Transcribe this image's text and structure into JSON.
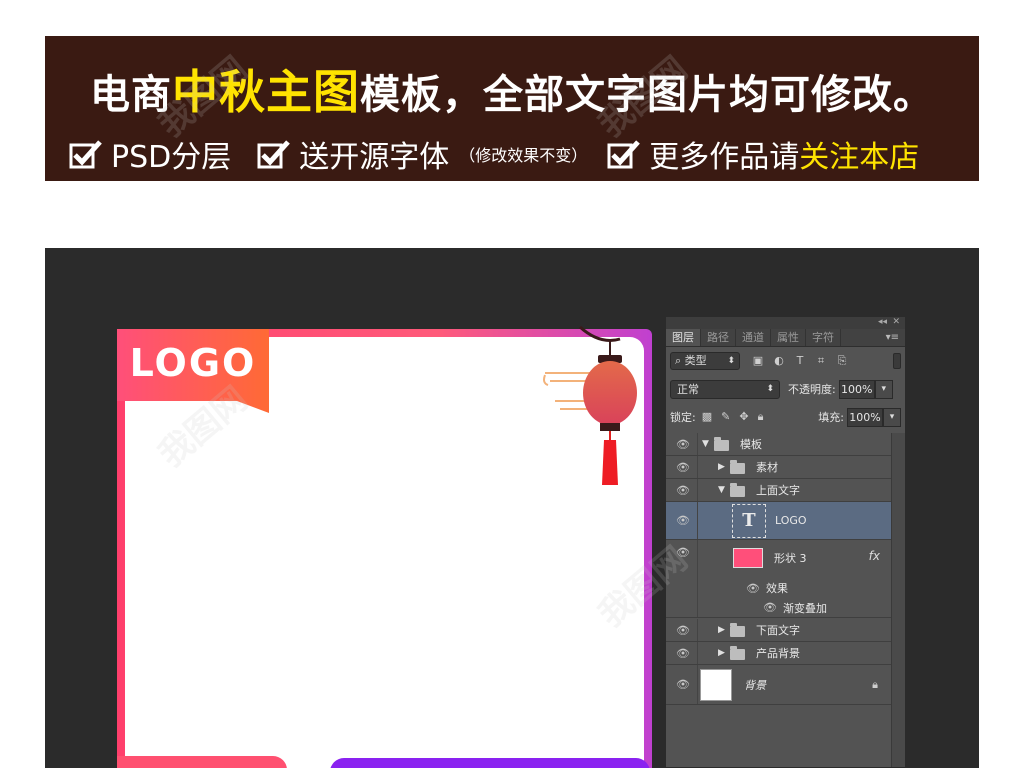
{
  "banner": {
    "title_prefix": "电商",
    "title_highlight": "中秋主图",
    "title_suffix": "模板，全部文字图片均可修改。",
    "features": [
      {
        "text": "PSD分层"
      },
      {
        "text": "送开源字体",
        "note": "（修改效果不变）"
      },
      {
        "text_prefix": "更多作品请",
        "text_highlight": "关注本店"
      }
    ]
  },
  "canvas": {
    "logo_text": "LOGO"
  },
  "layers_panel": {
    "tabs": [
      "图层",
      "路径",
      "通道",
      "属性",
      "字符"
    ],
    "active_tab": "图层",
    "filter": {
      "label": "类型"
    },
    "blend_mode": "正常",
    "opacity_label": "不透明度:",
    "opacity_value": "100%",
    "lock_label": "锁定:",
    "fill_label": "填充:",
    "fill_value": "100%",
    "layers": [
      {
        "name": "模板",
        "type": "group",
        "expanded": true
      },
      {
        "name": "素材",
        "type": "group",
        "expanded": false
      },
      {
        "name": "上面文字",
        "type": "group",
        "expanded": true
      },
      {
        "name": "LOGO",
        "type": "text",
        "selected": true
      },
      {
        "name": "形状 3",
        "type": "shape",
        "fx": "fx"
      },
      {
        "name": "效果",
        "type": "effect-header"
      },
      {
        "name": "渐变叠加",
        "type": "effect"
      },
      {
        "name": "下面文字",
        "type": "group",
        "expanded": false
      },
      {
        "name": "产品背景",
        "type": "group",
        "expanded": false
      },
      {
        "name": "背景",
        "type": "background",
        "locked": true
      }
    ]
  },
  "colors": {
    "banner_bg": "#3a1a12",
    "banner_highlight": "#ffe300",
    "dark_bg": "#2b2b2b",
    "card_pink": "#ff4f7a",
    "card_orange": "#ff6a3a",
    "card_purple": "#8a22f0",
    "panel_bg": "#535353",
    "selected_layer": "#5b6b82"
  },
  "icons": [
    "checkbox-checked-icon",
    "search-icon",
    "image-filter-icon",
    "adjust-filter-icon",
    "text-filter-icon",
    "shape-filter-icon",
    "smart-filter-icon",
    "eye-icon",
    "folder-icon",
    "disclosure-triangle-icon",
    "text-layer-icon",
    "lock-icon",
    "lantern-decoration"
  ]
}
